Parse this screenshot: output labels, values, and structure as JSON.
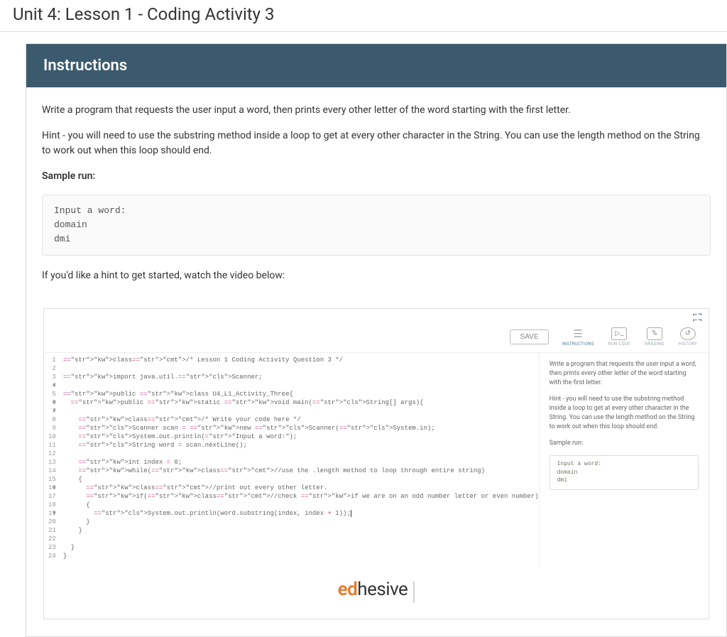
{
  "pageTitle": "Unit 4: Lesson 1 - Coding Activity 3",
  "header": "Instructions",
  "paragraph1": "Write a program that requests the user input a word, then prints every other letter of the word starting with the first letter.",
  "paragraph2": "Hint - you will need to use the substring method inside a loop to get at every other character in the String. You can use the length method on the String to work out when this loop should end.",
  "sampleLabel": "Sample run:",
  "sampleText": "Input a word:\ndomain\ndmi",
  "videoHint": "If you'd like a hint to get started, watch the video below:",
  "nested": {
    "save": "SAVE",
    "tabs": {
      "instructions": "INSTRUCTIONS",
      "runcode": "RUN CODE",
      "grading": "GRADING",
      "history": "HISTORY"
    },
    "code": {
      "lineCount": 24,
      "lines": [
        "/* Lesson 1 Coding Activity Question 3 */",
        "",
        "import java.util.Scanner;",
        "",
        "public class U4_L1_Activity_Three{",
        "  public static void main(String[] args){",
        "",
        "    /* Write your code here */",
        "    Scanner scan = new Scanner(System.in);",
        "    System.out.println(\"Input a word:\");",
        "    String word = scan.nextLine();",
        "",
        "    int index = 0;",
        "    while(//use the .length method to loop through entire string)",
        "    {",
        "      //print out every other letter.",
        "      if(//check if we are on an odd number letter or even number)",
        "      {",
        "        System.out.println(word.substring(index, index + 1));",
        "      }",
        "    }",
        "",
        "  }",
        "}"
      ]
    },
    "side": {
      "p1": "Write a program that requests the user input a word, then prints every other letter of the word starting with the first letter.",
      "p2": "Hint - you will need to use the substring method inside a loop to get at every other character in the String. You can use the length method on the String to work out when this loop should end.",
      "sampleLabel": "Sample run:",
      "sampleText": "Input a word:\ndomain\ndmi"
    }
  },
  "brand": {
    "part1": "ed",
    "part2": "hesive"
  }
}
